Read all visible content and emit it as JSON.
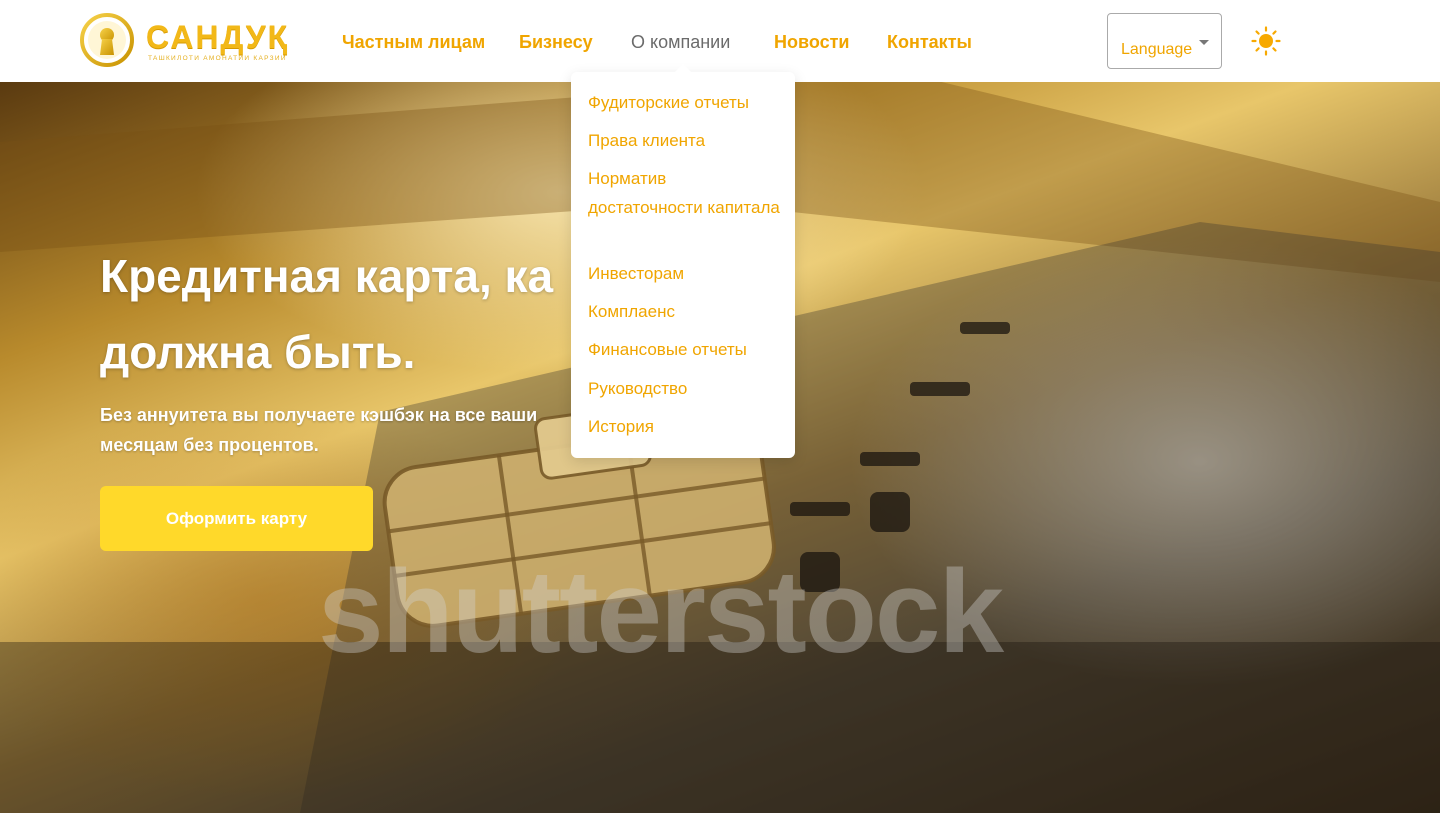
{
  "header": {
    "logo": {
      "word": "САНДУҚ",
      "tagline": "ТАШКИЛОТИ АМОНАТИИ КАРЗИИ ХУРД"
    },
    "nav": [
      {
        "label": "Частным лицам",
        "active": false
      },
      {
        "label": "Бизнесу",
        "active": false
      },
      {
        "label": "О компании",
        "active": true
      },
      {
        "label": "Новости",
        "active": false
      },
      {
        "label": "Контакты",
        "active": false
      }
    ],
    "language_label": "Language",
    "theme_icon": "sun-icon"
  },
  "dropdown": {
    "items": [
      "Фудиторские отчеты",
      "Права клиента",
      "Норматив достаточности капитала",
      "Инвесторам",
      "Комплаенс",
      "Финансовые отчеты",
      "Руководство",
      "История"
    ]
  },
  "hero": {
    "title_line1": "Кредитная карта, ка",
    "title_line2": "должна быть.",
    "subtitle_line1": "Без аннуитета вы получаете кэшбэк на все ваши",
    "subtitle_line2": "месяцам без процентов.",
    "cta_label": "Оформить карту",
    "watermark": "shutterstock"
  },
  "colors": {
    "accent": "#f0a500",
    "cta": "#ffd92a",
    "nav_active": "#6b6b6b"
  }
}
